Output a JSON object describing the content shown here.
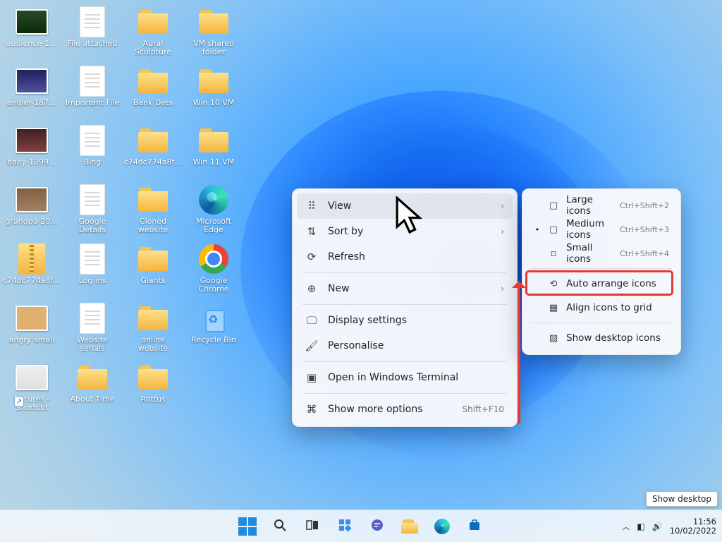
{
  "desktop_icons": {
    "col0": [
      {
        "type": "photo",
        "variant": "p0",
        "label": "audience-1…"
      },
      {
        "type": "photo",
        "variant": "p1",
        "label": "angler-187…"
      },
      {
        "type": "photo",
        "variant": "p2",
        "label": "baby-1399…"
      },
      {
        "type": "photo",
        "variant": "p3",
        "label": "grandpa-20…"
      },
      {
        "type": "zip",
        "label": "c74dc774a8f…"
      },
      {
        "type": "photo",
        "variant": "p4",
        "label": "angry small"
      },
      {
        "type": "photo",
        "variant": "p5",
        "shortcut": true,
        "label": "Pictures -\nShortcut"
      }
    ],
    "col1": [
      {
        "type": "file",
        "label": "File attached"
      },
      {
        "type": "file",
        "label": "Important File"
      },
      {
        "type": "file",
        "label": "Bing"
      },
      {
        "type": "file",
        "label": "Google\nDetails"
      },
      {
        "type": "file",
        "label": "Log ins"
      },
      {
        "type": "file",
        "label": "Website\nserials"
      },
      {
        "type": "folder",
        "label": "About Time"
      }
    ],
    "col2": [
      {
        "type": "folder",
        "label": "Aural\nSculpture"
      },
      {
        "type": "folder",
        "label": "Bank Dets"
      },
      {
        "type": "folder",
        "label": "c74dc774a8f…"
      },
      {
        "type": "folder",
        "label": "Cloned\nwebsite"
      },
      {
        "type": "folder",
        "label": "Giants"
      },
      {
        "type": "folder",
        "label": "online\nwebsite"
      },
      {
        "type": "folder",
        "label": "Rattus"
      }
    ],
    "col3": [
      {
        "type": "folder",
        "label": "VM shared\nfolder"
      },
      {
        "type": "folder",
        "label": "Win 10 VM"
      },
      {
        "type": "folder",
        "label": "Win 11 VM"
      },
      {
        "type": "edge",
        "label": "Microsoft\nEdge"
      },
      {
        "type": "chrome",
        "label": "Google\nChrome"
      },
      {
        "type": "recycle",
        "label": "Recycle Bin"
      }
    ]
  },
  "context_menu": {
    "items": [
      {
        "icon": "grid-icon",
        "label": "View",
        "tail": "›",
        "hi": true,
        "name": "ctx-view"
      },
      {
        "icon": "sort-icon",
        "label": "Sort by",
        "tail": "›",
        "name": "ctx-sort-by"
      },
      {
        "icon": "refresh-icon",
        "label": "Refresh",
        "name": "ctx-refresh"
      },
      {
        "sep": true
      },
      {
        "icon": "plus-icon",
        "label": "New",
        "tail": "›",
        "name": "ctx-new"
      },
      {
        "sep": true
      },
      {
        "icon": "display-icon",
        "label": "Display settings",
        "name": "ctx-display-settings"
      },
      {
        "icon": "personalise-icon",
        "label": "Personalise",
        "name": "ctx-personalise"
      },
      {
        "sep": true
      },
      {
        "icon": "terminal-icon",
        "label": "Open in Windows Terminal",
        "name": "ctx-open-terminal"
      },
      {
        "sep": true
      },
      {
        "icon": "more-icon",
        "label": "Show more options",
        "tail": "Shift+F10",
        "name": "ctx-show-more"
      }
    ]
  },
  "view_submenu": {
    "items": [
      {
        "check": "",
        "icon": "lg-icons-icon",
        "label": "Large icons",
        "shortcut": "Ctrl+Shift+2",
        "name": "sub-large-icons"
      },
      {
        "check": "•",
        "icon": "md-icons-icon",
        "label": "Medium icons",
        "shortcut": "Ctrl+Shift+3",
        "name": "sub-medium-icons"
      },
      {
        "check": "",
        "icon": "sm-icons-icon",
        "label": "Small icons",
        "shortcut": "Ctrl+Shift+4",
        "name": "sub-small-icons"
      },
      {
        "sep": true
      },
      {
        "check": "",
        "icon": "auto-arrange-icon",
        "label": "Auto arrange icons",
        "highlight": true,
        "name": "sub-auto-arrange"
      },
      {
        "check": "",
        "icon": "align-grid-icon",
        "label": "Align icons to grid",
        "name": "sub-align-grid"
      },
      {
        "sep": true
      },
      {
        "check": "",
        "icon": "show-desktop-icons-icon",
        "label": "Show desktop icons",
        "name": "sub-show-desktop-icons"
      }
    ]
  },
  "taskbar": {
    "buttons": [
      "start",
      "search",
      "task-view",
      "widgets",
      "chat",
      "file-explorer",
      "edge",
      "store"
    ],
    "system": {
      "time": "11:56",
      "date": "10/02/2022",
      "tooltip": "Show desktop"
    }
  },
  "icons": {
    "grid-icon": "⠿",
    "sort-icon": "⇅",
    "refresh-icon": "⟳",
    "plus-icon": "⊕",
    "display-icon": "🖵",
    "personalise-icon": "🖌",
    "terminal-icon": "▣",
    "more-icon": "⌘",
    "lg-icons-icon": "□",
    "md-icons-icon": "▢",
    "sm-icons-icon": "▫",
    "auto-arrange-icon": "⟲",
    "align-grid-icon": "▦",
    "show-desktop-icons-icon": "▧"
  }
}
